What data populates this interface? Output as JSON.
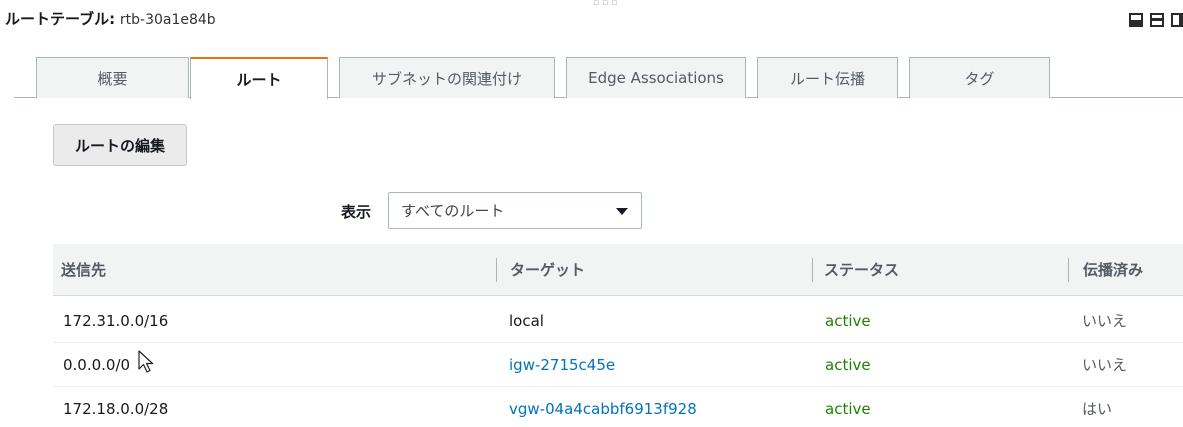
{
  "header": {
    "label": "ルートテーブル:",
    "route_table_id": "rtb-30a1e84b"
  },
  "tabs": [
    {
      "label": "概要"
    },
    {
      "label": "ルート"
    },
    {
      "label": "サブネットの関連付け"
    },
    {
      "label": "Edge Associations"
    },
    {
      "label": "ルート伝播"
    },
    {
      "label": "タグ"
    }
  ],
  "active_tab": "ルート",
  "toolbar": {
    "edit_label": "ルートの編集"
  },
  "filter": {
    "label": "表示",
    "selected": "すべてのルート"
  },
  "table": {
    "columns": [
      "送信先",
      "ターゲット",
      "ステータス",
      "伝播済み"
    ],
    "rows": [
      {
        "destination": "172.31.0.0/16",
        "target": "local",
        "status": "active",
        "propagated": "いいえ"
      },
      {
        "destination": "0.0.0.0/0",
        "target": "igw-2715c45e",
        "status": "active",
        "propagated": "いいえ"
      },
      {
        "destination": "172.18.0.0/28",
        "target": "vgw-04a4cabbf6913f928",
        "status": "active",
        "propagated": "はい"
      }
    ]
  },
  "colors": {
    "active_tab_accent": "#ec7211",
    "link": "#0073bb",
    "status_active": "#1d8102"
  },
  "icons": [
    "panel-bottom-icon",
    "panel-split-icon",
    "panel-side-icon",
    "dropdown-caret-icon",
    "mouse-pointer-icon"
  ]
}
